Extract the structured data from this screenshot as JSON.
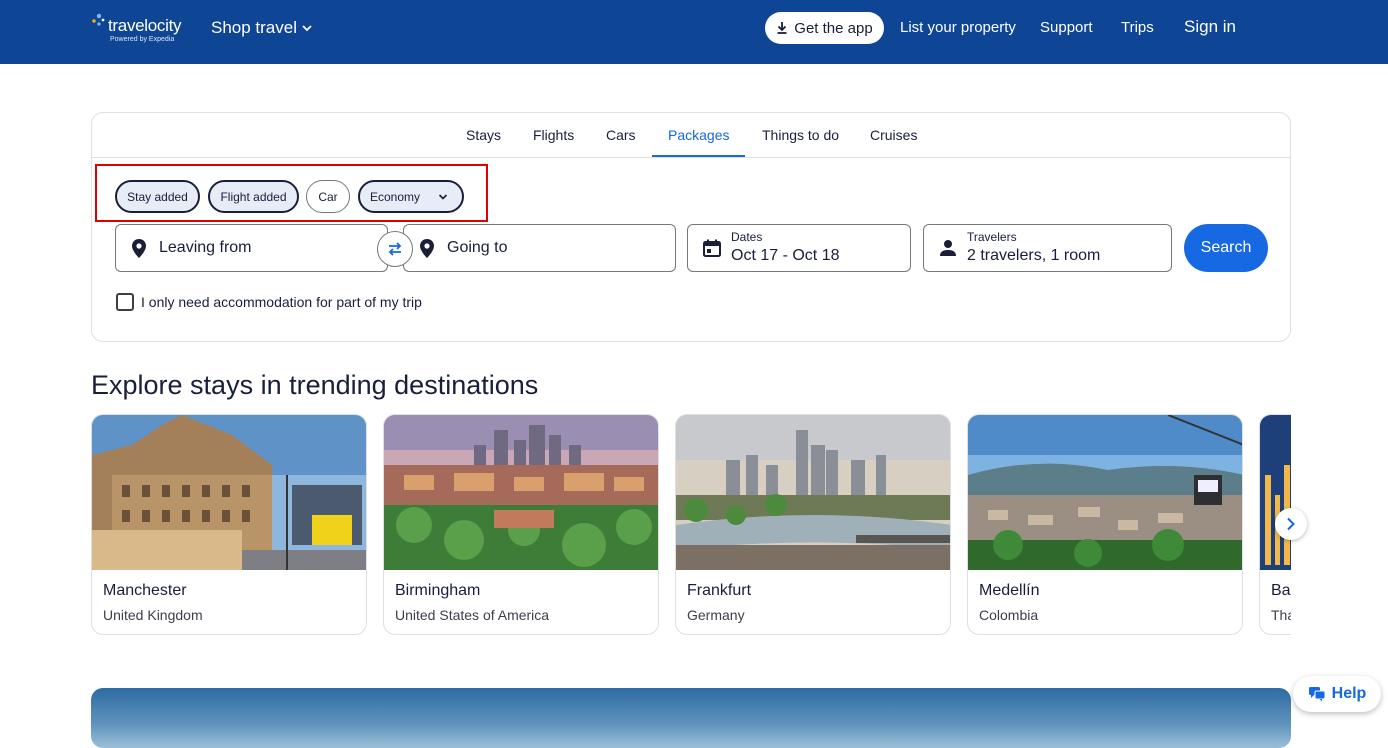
{
  "header": {
    "logo_text": "travelocity",
    "logo_sub": "Powered by Expedia",
    "shop_travel": "Shop travel",
    "get_app": "Get the app",
    "list_property": "List your property",
    "support": "Support",
    "trips": "Trips",
    "sign_in": "Sign in"
  },
  "tabs": [
    {
      "label": "Stays"
    },
    {
      "label": "Flights"
    },
    {
      "label": "Cars"
    },
    {
      "label": "Packages",
      "active": true
    },
    {
      "label": "Things to do"
    },
    {
      "label": "Cruises"
    }
  ],
  "chips": {
    "stay": "Stay added",
    "flight": "Flight added",
    "car": "Car",
    "cabin_class": "Economy"
  },
  "search": {
    "leaving_from": "Leaving from",
    "going_to": "Going to",
    "dates_label": "Dates",
    "dates_value": "Oct 17 - Oct 18",
    "travelers_label": "Travelers",
    "travelers_value": "2 travelers, 1 room",
    "search_button": "Search",
    "partial_stay_label": "I only need accommodation for part of my trip"
  },
  "explore": {
    "title": "Explore stays in trending destinations",
    "destinations": [
      {
        "city": "Manchester",
        "country": "United Kingdom"
      },
      {
        "city": "Birmingham",
        "country": "United States of America"
      },
      {
        "city": "Frankfurt",
        "country": "Germany"
      },
      {
        "city": "Medellín",
        "country": "Colombia"
      },
      {
        "city": "Ba",
        "country": "Tha"
      }
    ]
  },
  "help": "Help",
  "colors": {
    "header_bg": "#0e4595",
    "accent": "#1668e3",
    "highlight_box": "#e00000"
  }
}
